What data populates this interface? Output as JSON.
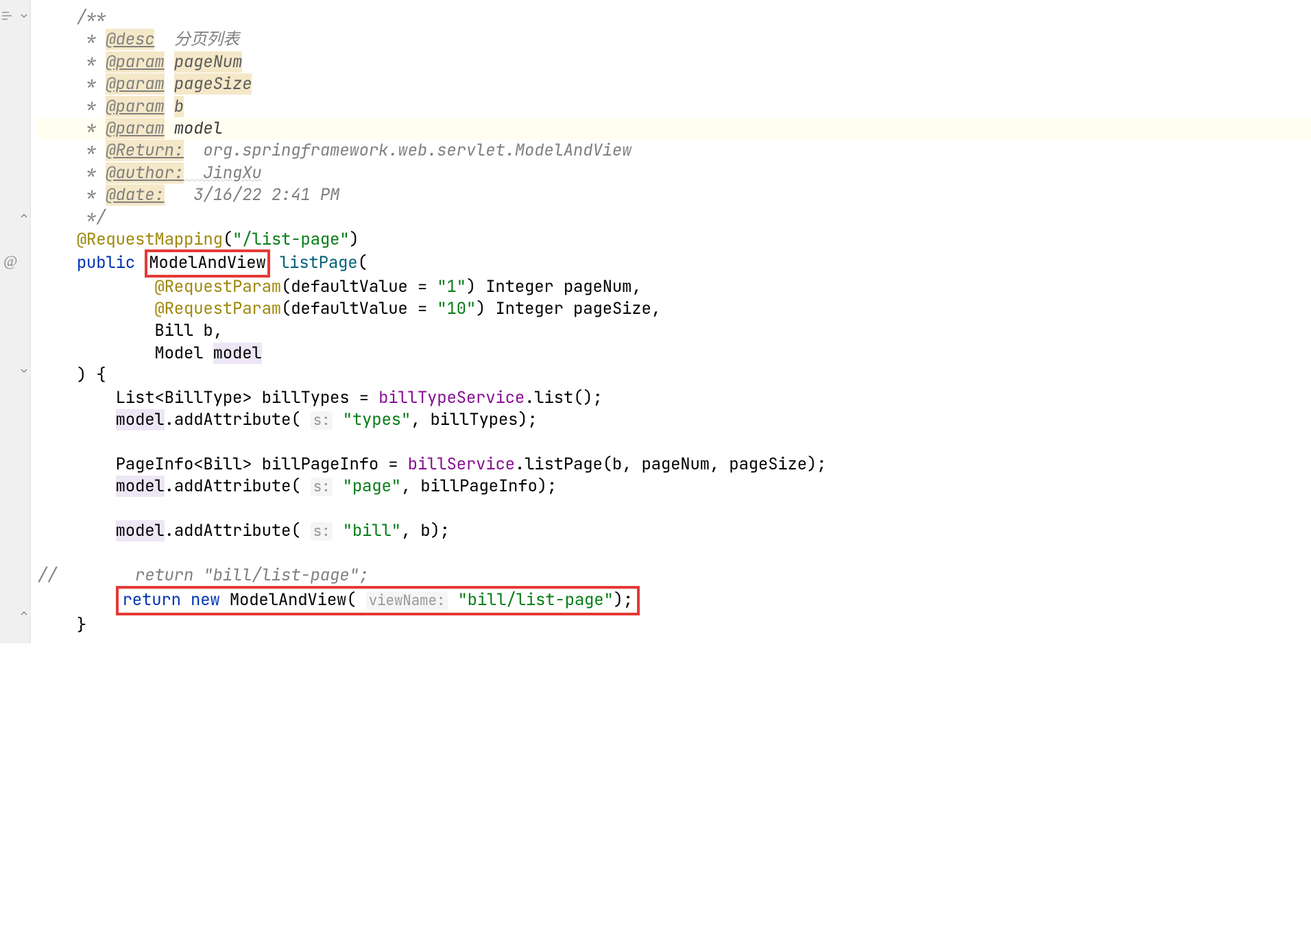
{
  "doc": {
    "open": "/**",
    "desc_star": " * ",
    "desc_tag": "@desc",
    "desc_text": "  分页列表",
    "param_tag": "@param",
    "param1": "pageNum",
    "param2": "pageSize",
    "param3": "b",
    "param4": "model",
    "return_tag": "@Return:",
    "return_text": "  org.springframework.web.servlet.ModelAndView",
    "author_tag": "@author:",
    "author_text": "  JingXu",
    "date_tag": "@date:",
    "date_text": "   3/16/22 2:41 PM",
    "close": " */"
  },
  "code": {
    "request_mapping": "@RequestMapping",
    "mapping_path": "\"/list-page\"",
    "public": "public",
    "model_view": "ModelAndView",
    "method_name": "listPage",
    "request_param": "@RequestParam",
    "default_value": "defaultValue = ",
    "dv1": "\"1\"",
    "dv2": "\"10\"",
    "integer": "Integer",
    "pageNum": "pageNum",
    "pageSize": "pageSize",
    "bill_type": "Bill",
    "b_var": "b",
    "model_type": "Model",
    "model_var": "model",
    "list_type": "List",
    "bill_type_generic": "BillType",
    "billTypes": "billTypes",
    "billTypeService": "billTypeService",
    "list_call": "list",
    "addAttribute": "addAttribute",
    "hint_s": "s:",
    "types_str": "\"types\"",
    "pageinfo": "PageInfo",
    "billPageInfo": "billPageInfo",
    "billService": "billService",
    "listPage": "listPage",
    "page_str": "\"page\"",
    "bill_str": "\"bill\"",
    "comment_return": "//        return \"bill/list-page\";",
    "return": "return",
    "new": "new",
    "hint_viewName": "viewName:",
    "view_path": "\"bill/list-page\""
  }
}
